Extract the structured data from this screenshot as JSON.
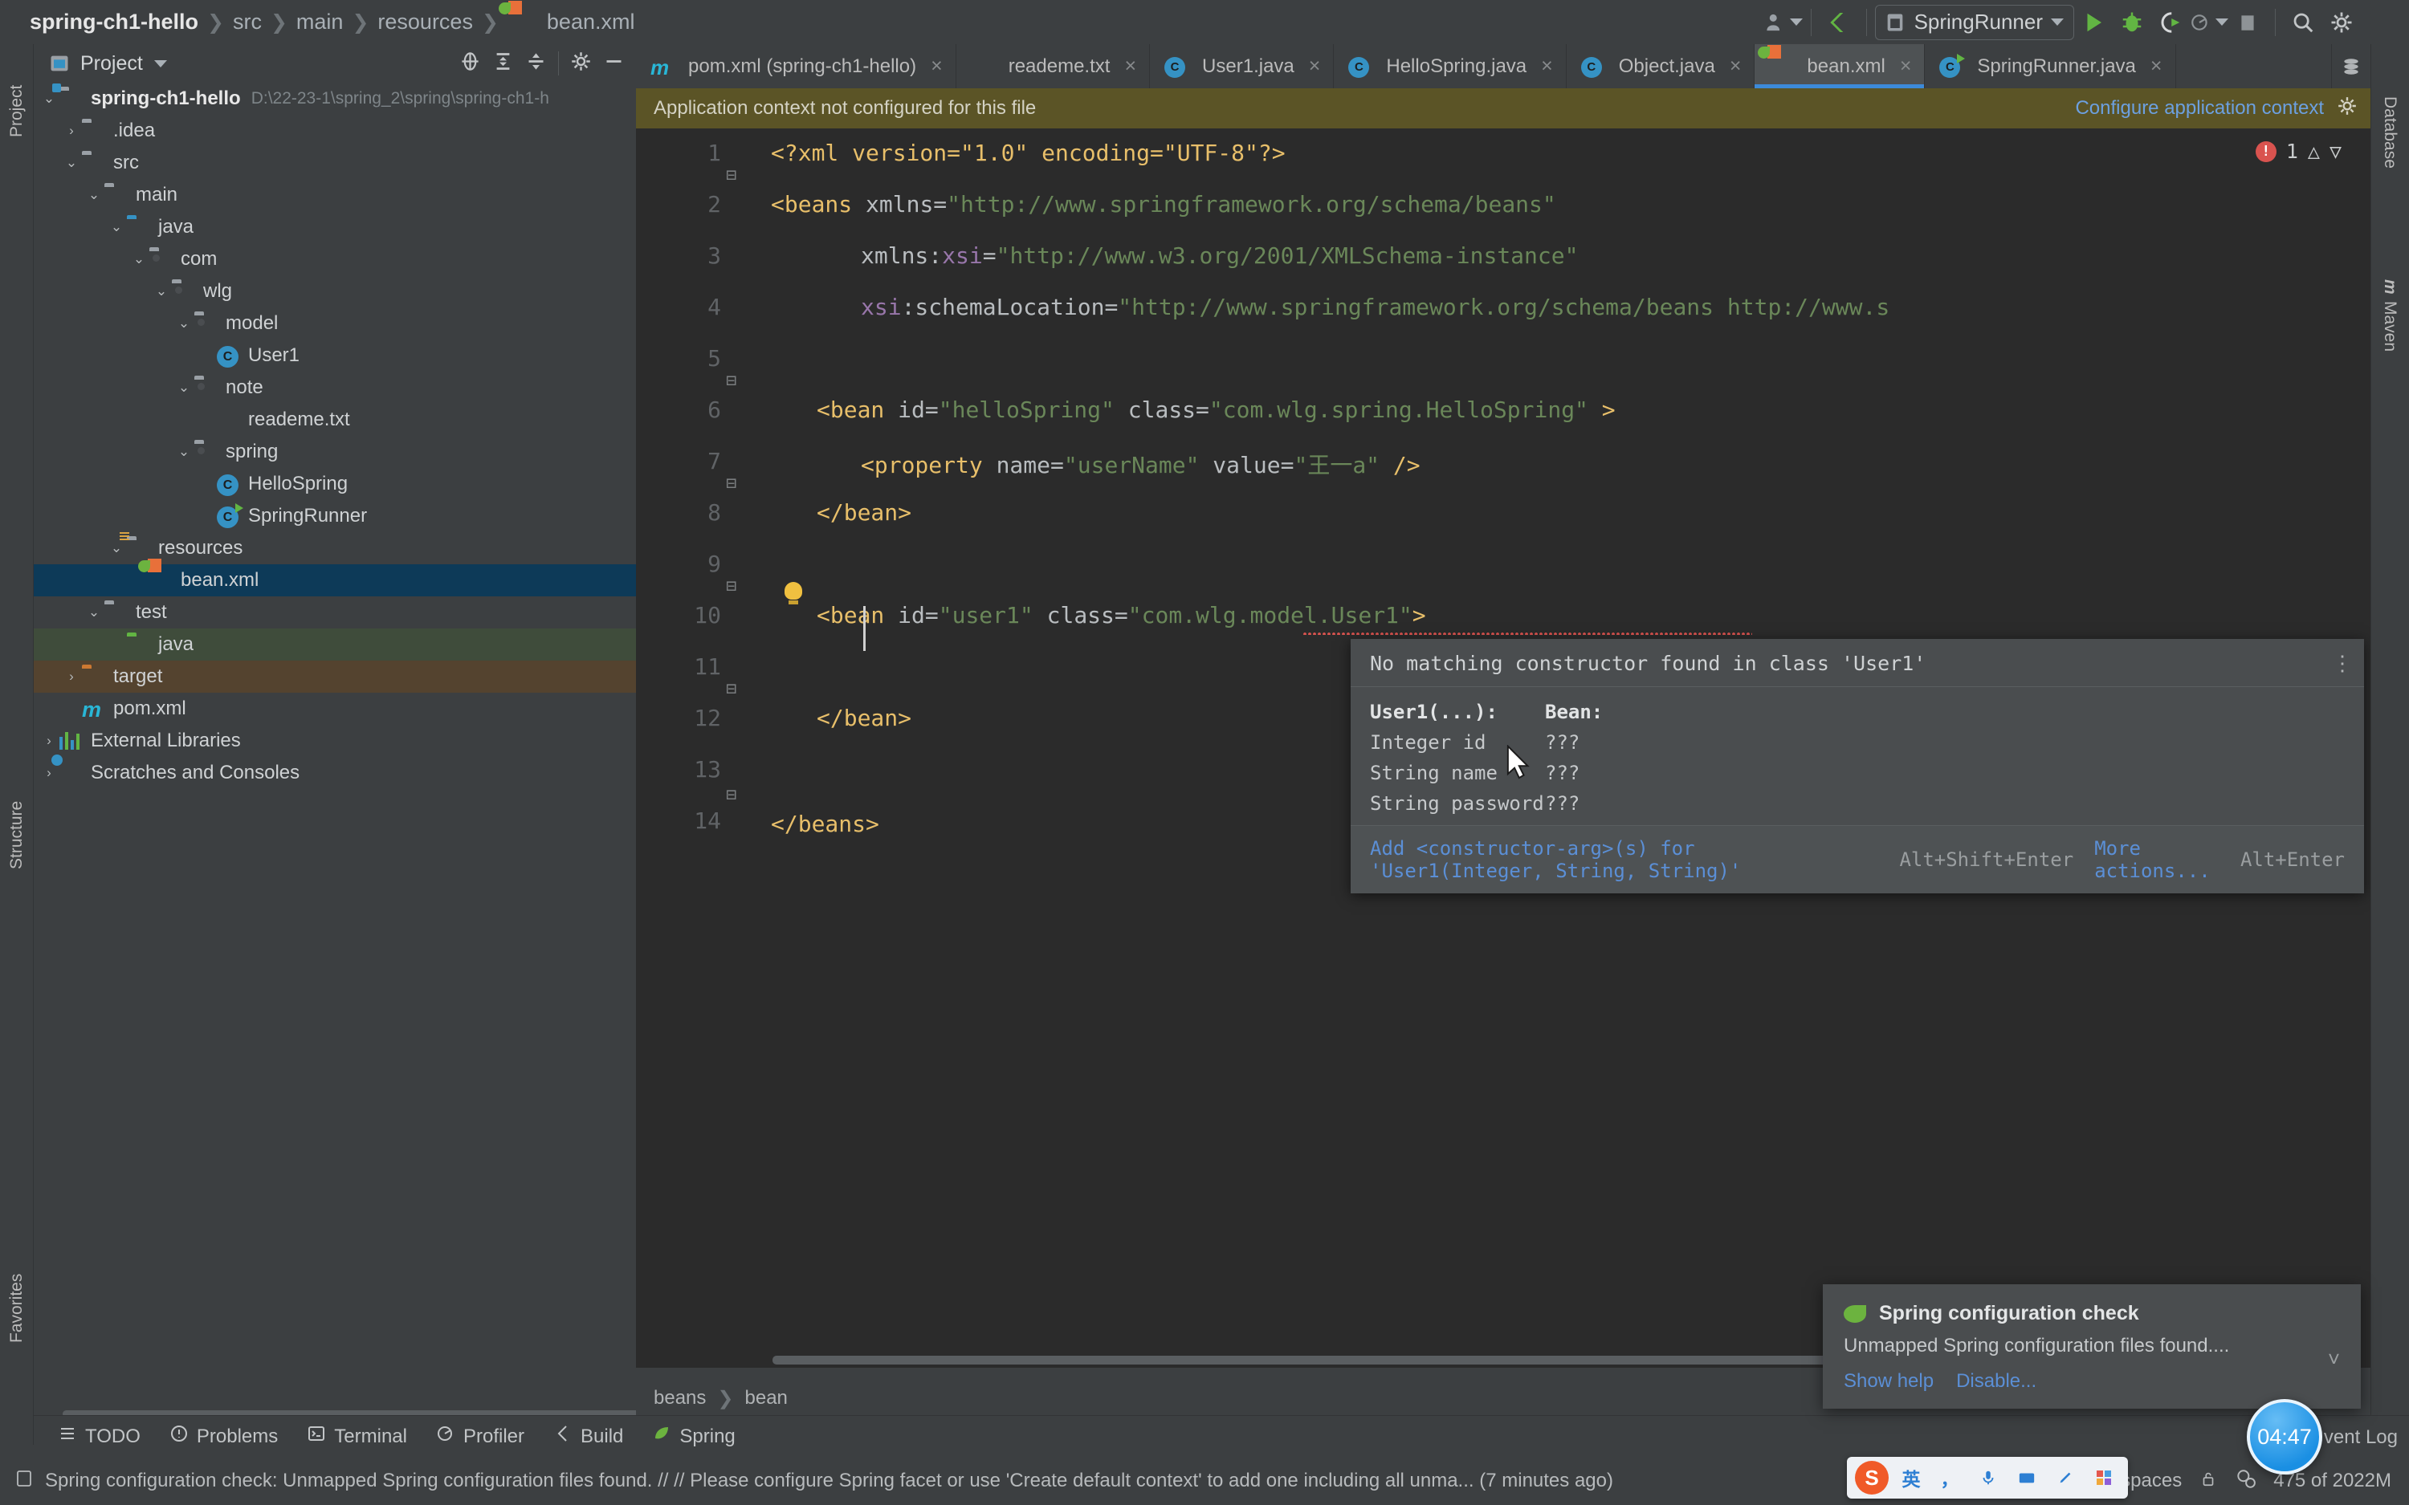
{
  "toolbar": {
    "breadcrumb": [
      "spring-ch1-hello",
      "src",
      "main",
      "resources",
      "bean.xml"
    ],
    "run_config": "SpringRunner",
    "icons": [
      "user-avatar-icon",
      "vcs-update-icon",
      "run-icon",
      "debug-icon",
      "run-coverage-icon",
      "profile-icon",
      "stop-icon",
      "search-icon",
      "settings-gear-icon",
      "ide-logo-icon"
    ]
  },
  "left_strip": {
    "labels": [
      "Project",
      "Structure",
      "Favorites"
    ]
  },
  "right_strip": {
    "labels": [
      "Database",
      "Maven"
    ]
  },
  "project_panel": {
    "title": "Project",
    "header_icons": [
      "locate-icon",
      "expand-all-icon",
      "collapse-all-icon",
      "settings-gear-icon",
      "hide-icon"
    ],
    "tree": [
      {
        "depth": 0,
        "arrow": "v",
        "icon": "module-folder-icon",
        "label": "spring-ch1-hello",
        "bold": true,
        "path": "D:\\22-23-1\\spring_2\\spring\\spring-ch1-h"
      },
      {
        "depth": 1,
        "arrow": ">",
        "icon": "folder-icon",
        "label": ".idea"
      },
      {
        "depth": 1,
        "arrow": "v",
        "icon": "folder-icon",
        "label": "src"
      },
      {
        "depth": 2,
        "arrow": "v",
        "icon": "folder-icon",
        "label": "main"
      },
      {
        "depth": 3,
        "arrow": "v",
        "icon": "source-folder-icon",
        "label": "java"
      },
      {
        "depth": 4,
        "arrow": "v",
        "icon": "package-icon",
        "label": "com"
      },
      {
        "depth": 5,
        "arrow": "v",
        "icon": "package-icon",
        "label": "wlg"
      },
      {
        "depth": 6,
        "arrow": "v",
        "icon": "package-icon",
        "label": "model"
      },
      {
        "depth": 7,
        "arrow": "",
        "icon": "java-class-icon",
        "label": "User1"
      },
      {
        "depth": 6,
        "arrow": "v",
        "icon": "package-icon",
        "label": "note"
      },
      {
        "depth": 7,
        "arrow": "",
        "icon": "text-file-icon",
        "label": "reademe.txt"
      },
      {
        "depth": 6,
        "arrow": "v",
        "icon": "package-icon",
        "label": "spring"
      },
      {
        "depth": 7,
        "arrow": "",
        "icon": "java-class-icon",
        "label": "HelloSpring"
      },
      {
        "depth": 7,
        "arrow": "",
        "icon": "java-runnable-class-icon",
        "label": "SpringRunner"
      },
      {
        "depth": 3,
        "arrow": "v",
        "icon": "resources-folder-icon",
        "label": "resources"
      },
      {
        "depth": 4,
        "arrow": "",
        "icon": "spring-xml-icon",
        "label": "bean.xml",
        "selected": true
      },
      {
        "depth": 2,
        "arrow": "v",
        "icon": "folder-icon",
        "label": "test"
      },
      {
        "depth": 3,
        "arrow": "",
        "icon": "test-source-folder-icon",
        "label": "java",
        "highlight": "green"
      },
      {
        "depth": 1,
        "arrow": ">",
        "icon": "excluded-folder-icon",
        "label": "target",
        "highlight": "orange"
      },
      {
        "depth": 1,
        "arrow": "",
        "icon": "maven-icon",
        "label": "pom.xml"
      },
      {
        "depth": 0,
        "arrow": ">",
        "icon": "external-libraries-icon",
        "label": "External Libraries"
      },
      {
        "depth": 0,
        "arrow": ">",
        "icon": "scratches-icon",
        "label": "Scratches and Consoles"
      }
    ]
  },
  "editor": {
    "tabs": [
      {
        "icon": "maven-icon",
        "label": "pom.xml (spring-ch1-hello)",
        "active": false,
        "close": "×"
      },
      {
        "icon": "text-file-icon",
        "label": "reademe.txt",
        "active": false,
        "close": "×"
      },
      {
        "icon": "java-class-icon",
        "label": "User1.java",
        "active": false,
        "close": "×"
      },
      {
        "icon": "java-class-icon",
        "label": "HelloSpring.java",
        "active": false,
        "close": "×"
      },
      {
        "icon": "java-class-icon",
        "label": "Object.java",
        "active": false,
        "close": "×"
      },
      {
        "icon": "spring-xml-icon",
        "label": "bean.xml",
        "active": true,
        "close": "×"
      },
      {
        "icon": "java-runnable-class-icon",
        "label": "SpringRunner.java",
        "active": false,
        "close": "×"
      }
    ],
    "banner": {
      "message": "Application context not configured for this file",
      "action": "Configure application context",
      "gear": "settings-gear-icon"
    },
    "error_count": "1",
    "breadcrumb": [
      "beans",
      "bean"
    ],
    "lines": [
      {
        "n": "1"
      },
      {
        "n": "2"
      },
      {
        "n": "3"
      },
      {
        "n": "4"
      },
      {
        "n": "5"
      },
      {
        "n": "6"
      },
      {
        "n": "7"
      },
      {
        "n": "8"
      },
      {
        "n": "9"
      },
      {
        "n": "10"
      },
      {
        "n": "11"
      },
      {
        "n": "12"
      },
      {
        "n": "13"
      },
      {
        "n": "14"
      }
    ],
    "code": {
      "l1": "<?xml version=\"1.0\" encoding=\"UTF-8\"?>",
      "l2_tag": "<beans",
      "l2_attr": " xmlns=",
      "l2_val": "\"http://www.springframework.org/schema/beans\"",
      "l3_attr": "xmlns:",
      "l3_ns": "xsi",
      "l3_eq": "=",
      "l3_val": "\"http://www.w3.org/2001/XMLSchema-instance\"",
      "l4_ns": "xsi",
      "l4_attr": ":schemaLocation=",
      "l4_val": "\"http://www.springframework.org/schema/beans http://www.s",
      "l6_tag": "<bean",
      "l6_a1": " id=",
      "l6_v1": "\"helloSpring\"",
      "l6_a2": " class=",
      "l6_v2": "\"com.wlg.spring.HelloSpring\"",
      "l6_end": " >",
      "l7_tag": "<property",
      "l7_a1": " name=",
      "l7_v1": "\"userName\"",
      "l7_a2": " value=",
      "l7_v2": "\"王一a\"",
      "l7_end": " />",
      "l8": "</bean>",
      "l10_tag": "<bean",
      "l10_a1": " id=",
      "l10_v1": "\"user1\"",
      "l10_a2": " class=",
      "l10_v2": "\"com.wlg.model.User1\"",
      "l10_end": ">",
      "l12": "</bean>",
      "l14": "</beans>"
    }
  },
  "inspection_popup": {
    "title": "No matching constructor found in class 'User1'",
    "col1_header": "User1(...):",
    "col2_header": "Bean:",
    "rows": [
      {
        "param": "Integer id",
        "bean": "???"
      },
      {
        "param": "String name",
        "bean": "???"
      },
      {
        "param": "String password",
        "bean": "???"
      }
    ],
    "footer": {
      "primary_action": "Add <constructor-arg>(s) for 'User1(Integer, String, String)'",
      "primary_shortcut": "Alt+Shift+Enter",
      "secondary_action": "More actions...",
      "secondary_shortcut": "Alt+Enter"
    },
    "menu_icon": "more-options-icon"
  },
  "tool_windows": [
    {
      "icon": "todo-icon",
      "label": "TODO"
    },
    {
      "icon": "problems-icon",
      "label": "Problems"
    },
    {
      "icon": "terminal-icon",
      "label": "Terminal"
    },
    {
      "icon": "profiler-icon",
      "label": "Profiler"
    },
    {
      "icon": "build-icon",
      "label": "Build"
    },
    {
      "icon": "spring-leaf-icon",
      "label": "Spring"
    }
  ],
  "status_bar": {
    "icon": "event-log-icon",
    "message": "Spring configuration check: Unmapped Spring configuration files found. // // Please configure Spring facet or use 'Create default context' to add one including all unma... (7 minutes ago)",
    "memory": "475 of 2022M",
    "indent": "4 spaces",
    "event_log": "vent Log",
    "lock_icon": "lock-icon",
    "inspection_icon": "inspections-icon"
  },
  "balloon": {
    "icon": "spring-leaf-icon",
    "title": "Spring configuration check",
    "message": "Unmapped Spring configuration files found....",
    "links": [
      "Show help",
      "Disable..."
    ],
    "collapse": "chevron-down-icon"
  },
  "timer": {
    "value": "04:47"
  },
  "ime": {
    "icon": "sogou-logo-icon",
    "keys": [
      "英",
      "，",
      "🎤",
      "⌨",
      "✎",
      "⊞"
    ]
  },
  "colors": {
    "accent_blue": "#3d8ad8",
    "selection": "#0d3a58",
    "error_red": "#d9534f",
    "string_green": "#6a8759",
    "tag_yellow": "#e8bf6a",
    "banner_olive": "#5b5426"
  }
}
